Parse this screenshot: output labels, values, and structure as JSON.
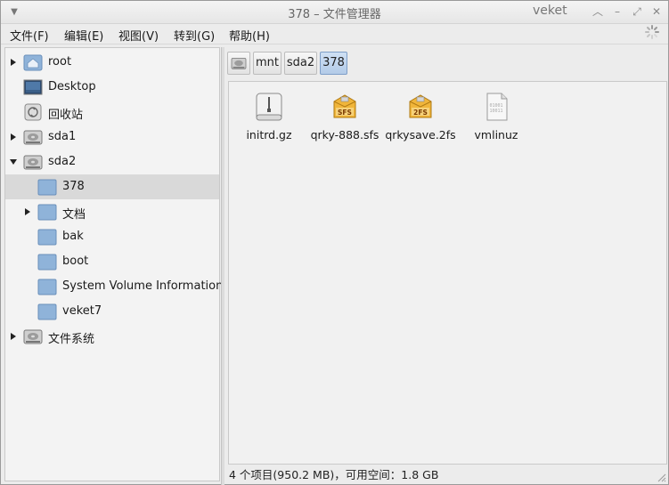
{
  "window": {
    "title": "378 – 文件管理器",
    "brand": "veket"
  },
  "menu": [
    {
      "label": "文件(F)"
    },
    {
      "label": "编辑(E)"
    },
    {
      "label": "视图(V)"
    },
    {
      "label": "转到(G)"
    },
    {
      "label": "帮助(H)"
    }
  ],
  "tree": [
    {
      "label": "root",
      "icon": "home-folder-icon",
      "expander": "collapsed"
    },
    {
      "label": "Desktop",
      "icon": "desktop-icon",
      "expander": "none"
    },
    {
      "label": "回收站",
      "icon": "trash-icon",
      "expander": "none"
    },
    {
      "label": "sda1",
      "icon": "drive-icon",
      "expander": "collapsed"
    },
    {
      "label": "sda2",
      "icon": "drive-icon",
      "expander": "expanded"
    },
    {
      "label": "378",
      "icon": "folder-icon",
      "expander": "none",
      "selected": true
    },
    {
      "label": "文档",
      "icon": "folder-icon",
      "expander": "collapsed"
    },
    {
      "label": "bak",
      "icon": "folder-icon",
      "expander": "none"
    },
    {
      "label": "boot",
      "icon": "folder-icon",
      "expander": "none"
    },
    {
      "label": "System Volume Information",
      "icon": "folder-icon",
      "expander": "none"
    },
    {
      "label": "veket7",
      "icon": "folder-icon",
      "expander": "none"
    },
    {
      "label": "文件系统",
      "icon": "drive-icon",
      "expander": "collapsed"
    }
  ],
  "pathbar": {
    "crumbs": [
      {
        "label": "",
        "icon": "drive-icon"
      },
      {
        "label": "mnt"
      },
      {
        "label": "sda2"
      },
      {
        "label": "378",
        "active": true
      }
    ]
  },
  "files": [
    {
      "name": "initrd.gz",
      "icon": "archive-icon"
    },
    {
      "name": "qrky-888.sfs",
      "icon": "sfs-package-icon",
      "badge": "SFS"
    },
    {
      "name": "qrkysave.2fs",
      "icon": "sfs-package-icon",
      "badge": "2FS"
    },
    {
      "name": "vmlinuz",
      "icon": "binary-file-icon"
    }
  ],
  "status": {
    "text": "4 个项目(950.2 MB)，可用空间：1.8 GB"
  },
  "colors": {
    "folder": "#8fb3d9",
    "selection": "#d9d9d9",
    "crumb_active": "#b3cbe8"
  }
}
